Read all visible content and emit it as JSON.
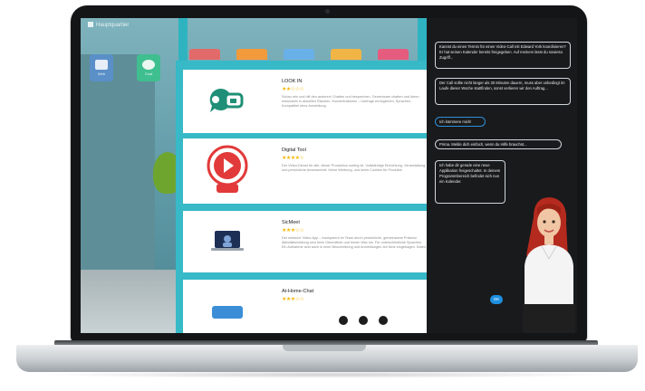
{
  "window": {
    "title": "Hauptquartier"
  },
  "desktop_icons": [
    {
      "label": "Web",
      "icon": "browser-icon"
    },
    {
      "label": "Chat",
      "icon": "chat-icon"
    }
  ],
  "store": {
    "apps": [
      {
        "name": "LOOK IN",
        "rating": 2,
        "icon": "video-chat-icon",
        "description": "Schau rein und hilf den anderen! Chatten und besprechen. Gemeinsam chatten und Ideen entwickeln in aktuellen Räumen. Konzentrationen – Umfrage ermöglichen, Sprachen, Kompatibel ohne Anmeldung."
      },
      {
        "name": "Digital Tool",
        "rating": 4,
        "icon": "live-play-icon",
        "badge": "Live",
        "description": "Der Video-Dienst für alle, dieser Produktion sorting ist. Vollständige Einrichtung, Veranstaltung und persönliche Anwesenheit. Keine Werbung, und keine Cookies für Produkte."
      },
      {
        "name": "SicMeet",
        "rating": 3,
        "icon": "laptop-meeting-icon",
        "description": "Der einfache Video-App – transparent im Team durch persönliche, gemeinsame Präsenz. Aktivitätsmeldung sind beim Übermitteln und lernen Max los. Für unterschiedliche Sprachen. Ein Aufnahme sind auch in einer Beschreibung und Anmeldungen am Netz eingetragen. Daten."
      },
      {
        "name": "At-Home-Chat",
        "rating": 3,
        "icon": "home-chat-icon",
        "description": ""
      }
    ]
  },
  "chat": {
    "messages": [
      {
        "from": "assistant",
        "text": "Kannst du einen Termin für einen Video-Call mit Edward York koordinieren? Er hat seinen Kalender bereits freigegeben. Auf meinem lässt du sowieso Zugriff..."
      },
      {
        "from": "assistant",
        "text": "Der Call sollte nicht länger als 30 Minuten dauern, muss aber unbedingt im Laufe dieser Woche stattfinden, sonst verlieren wir den Auftrag..."
      },
      {
        "from": "user",
        "text": "Ich kümmere mich!"
      },
      {
        "from": "assistant",
        "text": "Prima. Melde dich einfach, wenn du Hilfe brauchst..."
      },
      {
        "from": "assistant",
        "text": "Ich habe dir gerade eine neue Applikation freigeschaltet. In deinem Programmbereich befindet sich nun ein Kalender."
      }
    ],
    "ok_label": "OK"
  },
  "colors": {
    "accent": "#37b9c7",
    "chat_bg": "#191a1c",
    "user_bubble_border": "#2f8fd8"
  }
}
